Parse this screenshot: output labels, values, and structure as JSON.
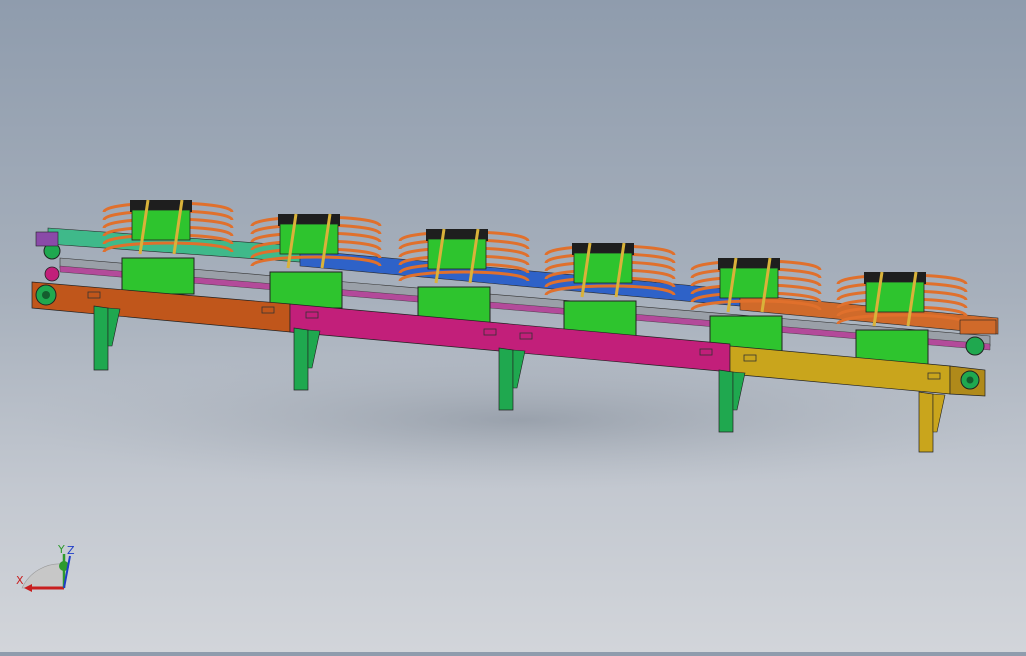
{
  "viewport": {
    "background_top": "#8f9cad",
    "background_bottom": "#d2d5da",
    "model": {
      "frame_colors": [
        "#c0561b",
        "#c21f7a",
        "#c9a51c"
      ],
      "leg_color": "#1fa84f",
      "carrier_color": "#2ec42e",
      "coil_color": "#e0702c",
      "rail_colors": [
        "#2e62c8",
        "#3fb98a",
        "#d06a2a",
        "#9aa0a8"
      ],
      "carrier_count": 6,
      "leg_count": 5
    }
  },
  "triad": {
    "x_label": "X",
    "y_label": "Y",
    "z_label": "Z",
    "x_color": "#c81e1e",
    "y_color": "#2d9a2d",
    "z_color": "#1e3cc8"
  }
}
